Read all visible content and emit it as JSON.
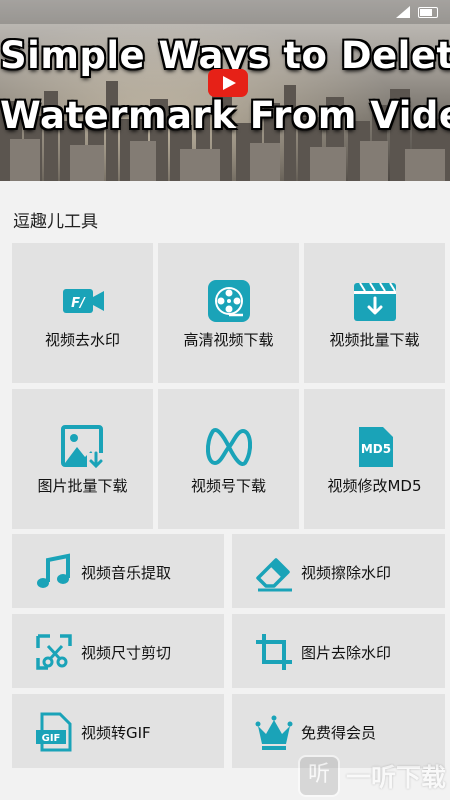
{
  "banner": {
    "title_line1": "Simple Ways to Delete",
    "title_line2": "Watermark From Video"
  },
  "section_title": "逗趣儿工具",
  "tools": [
    {
      "label": "视频去水印",
      "icon": "video-watermark-icon"
    },
    {
      "label": "高清视频下载",
      "icon": "film-reel-icon"
    },
    {
      "label": "视频批量下载",
      "icon": "clapper-download-icon"
    },
    {
      "label": "图片批量下载",
      "icon": "image-download-icon"
    },
    {
      "label": "视频号下载",
      "icon": "channels-icon"
    },
    {
      "label": "视频修改MD5",
      "icon": "md5-file-icon"
    },
    {
      "label": "视频音乐提取",
      "icon": "music-note-icon"
    },
    {
      "label": "视频擦除水印",
      "icon": "eraser-icon"
    },
    {
      "label": "视频尺寸剪切",
      "icon": "crop-scissors-icon"
    },
    {
      "label": "图片去除水印",
      "icon": "crop-icon"
    },
    {
      "label": "视频转GIF",
      "icon": "gif-file-icon"
    },
    {
      "label": "免费得会员",
      "icon": "crown-icon"
    }
  ],
  "watermark": {
    "icon_text": "听",
    "text": "一听下载"
  },
  "colors": {
    "accent": "#1aa3b8",
    "tile": "#e2e2e2",
    "background": "#f2f2f2"
  }
}
